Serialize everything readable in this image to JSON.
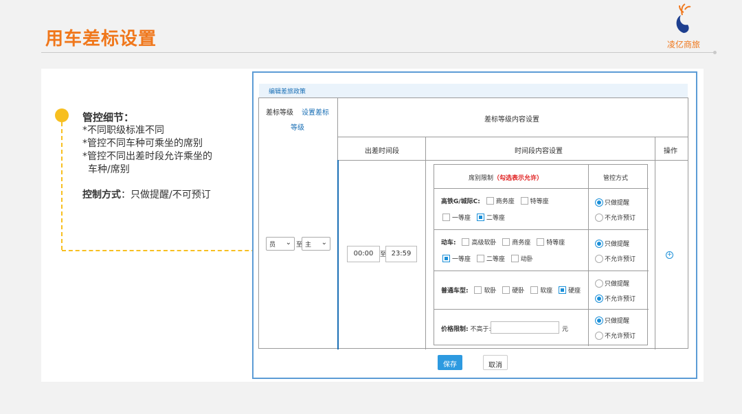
{
  "slide": {
    "title": "用车差标设置",
    "logo_text": "凌亿商旅"
  },
  "notes": {
    "heading": "管控细节：",
    "items": [
      "*不同职级标准不同",
      "*管控不同车种可乘坐的席别",
      "*管控不同出差时段允许乘坐的",
      "车种/席别"
    ],
    "method_label": "控制方式",
    "method_value": "：只做提醒/不可预订"
  },
  "form": {
    "header": "编辑差旅政策",
    "col_level": "差标等级",
    "set_level_link_1": "设置差标",
    "set_level_link_2": "等级",
    "col_content": "差标等级内容设置",
    "col_period": "出差时间段",
    "col_period_content": "时间段内容设置",
    "col_action": "操作",
    "level_from": "员",
    "level_to_label": "至",
    "level_to": "主",
    "time_from": "00:00",
    "time_to_label": "至",
    "time_to": "23:59",
    "seat_header": "席别限制",
    "seat_header_note": "（勾选表示允许）",
    "control_header": "管控方式",
    "rows": {
      "gaotie": {
        "label": "高铁G/城际C:",
        "options": [
          {
            "label": "商务座",
            "checked": false
          },
          {
            "label": "特等座",
            "checked": false
          },
          {
            "label": "一等座",
            "checked": false
          },
          {
            "label": "二等座",
            "checked": true
          }
        ],
        "control": "只做提醒"
      },
      "dongche": {
        "label": "动车:",
        "options": [
          {
            "label": "高级软卧",
            "checked": false
          },
          {
            "label": "商务座",
            "checked": false
          },
          {
            "label": "特等座",
            "checked": false
          },
          {
            "label": "一等座",
            "checked": true
          },
          {
            "label": "二等座",
            "checked": false
          },
          {
            "label": "动卧",
            "checked": false
          }
        ],
        "control": "只做提醒"
      },
      "putong": {
        "label": "普通车型:",
        "options": [
          {
            "label": "软卧",
            "checked": false
          },
          {
            "label": "硬卧",
            "checked": false
          },
          {
            "label": "软座",
            "checked": false
          },
          {
            "label": "硬座",
            "checked": true
          }
        ],
        "control": "不允许预订"
      },
      "price": {
        "label": "价格限制:",
        "sub_label": "不高于:",
        "value": "",
        "unit": "元",
        "control": "只做提醒"
      }
    },
    "control_options": [
      "只做提醒",
      "不允许预订"
    ],
    "save_label": "保存",
    "cancel_label": "取消"
  },
  "colors": {
    "accent": "#f0771b",
    "connector": "#f7bf20",
    "primary_blue": "#2d9ae0",
    "warning_red": "#e02020"
  }
}
